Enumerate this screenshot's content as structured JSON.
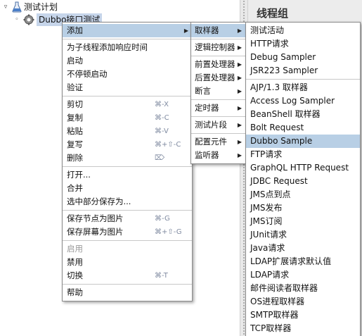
{
  "tree": {
    "root_label": "测试计划",
    "child_label": "Dubbo接口测试"
  },
  "panel": {
    "title": "线程组"
  },
  "main_menu": {
    "add": "添加",
    "add_response_time": "为子线程添加响应时间",
    "start": "启动",
    "start_no_pause": "不停顿启动",
    "validate": "验证",
    "cut": "剪切",
    "cut_shortcut": "⌘-X",
    "copy": "复制",
    "copy_shortcut": "⌘-C",
    "paste": "粘贴",
    "paste_shortcut": "⌘-V",
    "duplicate": "复写",
    "duplicate_shortcut": "⌘+⇧-C",
    "delete": "删除",
    "delete_shortcut": "⌦",
    "open": "打开...",
    "merge": "合并",
    "save_selection": "选中部分保存为...",
    "save_node_image": "保存节点为图片",
    "save_node_image_shortcut": "⌘-G",
    "save_screen_image": "保存屏幕为图片",
    "save_screen_image_shortcut": "⌘+⇧-G",
    "enable": "启用",
    "disable": "禁用",
    "toggle": "切换",
    "toggle_shortcut": "⌘-T",
    "help": "帮助"
  },
  "add_submenu": {
    "sampler": "取样器",
    "logic_controller": "逻辑控制器",
    "pre_processor": "前置处理器",
    "post_processor": "后置处理器",
    "assertion": "断言",
    "timer": "定时器",
    "test_fragment": "测试片段",
    "config_element": "配置元件",
    "listener": "监听器"
  },
  "sampler_submenu": {
    "items": [
      "测试活动",
      "HTTP请求",
      "Debug Sampler",
      "JSR223 Sampler",
      "AJP/1.3 取样器",
      "Access Log Sampler",
      "BeanShell 取样器",
      "Bolt Request",
      "Dubbo Sample",
      "FTP请求",
      "GraphQL HTTP Request",
      "JDBC Request",
      "JMS点到点",
      "JMS发布",
      "JMS订阅",
      "JUnit请求",
      "Java请求",
      "LDAP扩展请求默认值",
      "LDAP请求",
      "邮件阅读者取样器",
      "OS进程取样器",
      "SMTP取样器",
      "TCP取样器"
    ]
  },
  "colors": {
    "highlight": "#b8cfe5",
    "disabled_text": "#9a9a9a",
    "shortcut_text": "#7f8aa0"
  }
}
